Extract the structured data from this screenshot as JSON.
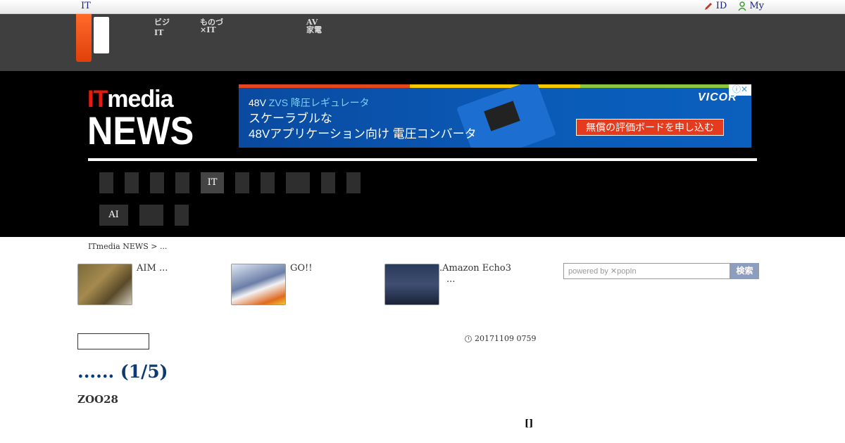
{
  "utilbar": {
    "it_link": "IT",
    "id_link": "ID",
    "my_link": "My"
  },
  "network_nav": [
    {
      "line1": "ビジ",
      "line2": "IT"
    },
    {
      "line1": "ものづ",
      "line2": "×IT"
    },
    {
      "line1": "AV",
      "line2": "家電"
    }
  ],
  "brand": {
    "it": "IT",
    "media": "media",
    "news": "NEWS"
  },
  "ad": {
    "line1_prefix": "48V",
    "line1_highlight": " ZVS 降圧レギュレータ",
    "line2a": "スケーラブルな",
    "line2b": "48Vアプリケーション向け 電圧コンバータ",
    "brand_name": "VICOR",
    "cta": "無償の評価ボードを申し込む",
    "adchoice": "ⓘ✕",
    "stripe_colors": [
      "#e5461d",
      "#f7c800",
      "#8cc63f"
    ]
  },
  "tabs_row1": [
    "",
    "",
    "",
    "",
    "IT",
    "",
    "",
    "",
    "",
    ""
  ],
  "tabs_row2": [
    "AI",
    "",
    ""
  ],
  "breadcrumb": "ITmedia NEWS > ...",
  "related": [
    {
      "text": "AIM ..."
    },
    {
      "text": "GO!!"
    },
    {
      "text": ".Amazon Echo3",
      "text2": "..."
    }
  ],
  "search": {
    "placeholder": "powered by ✕popIn",
    "button": "検索"
  },
  "article": {
    "date": "20171109 0759",
    "headline": "...... (1/5)",
    "subtitle": "ZOO28",
    "bracket": "[]"
  }
}
